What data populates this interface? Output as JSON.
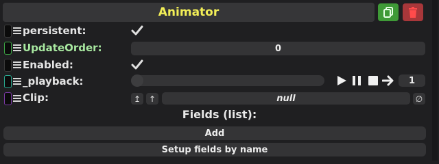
{
  "header": {
    "title": "Animator"
  },
  "actions": {
    "copy_icon": "copy-icon",
    "delete_icon": "trash-icon"
  },
  "rows": [
    {
      "label": "persistent:",
      "type": "checkbox",
      "checked": true,
      "handle_color": "#3a3a3a"
    },
    {
      "label": "UpdateOrder:",
      "type": "number",
      "value": "0",
      "handle_color": "#3da845"
    },
    {
      "label": "Enabled:",
      "type": "checkbox",
      "checked": true,
      "handle_color": "#3a3a3a"
    },
    {
      "label": "_playback:",
      "type": "playback",
      "value": "1",
      "handle_color": "#2aa88f"
    },
    {
      "label": "Clip:",
      "type": "reference",
      "value": "null",
      "handle_color": "#7d3aa8"
    }
  ],
  "clip_buttons": {
    "left": "↥",
    "up": "↑",
    "clear": "∅"
  },
  "fields": {
    "title": "Fields (list):"
  },
  "buttons": {
    "add": "Add",
    "setup": "Setup fields by name"
  },
  "colors": {
    "title": "#f2ee57",
    "copy": "#3f9a37",
    "delete": "#a8373a",
    "green_label": "#a8e8a0"
  }
}
